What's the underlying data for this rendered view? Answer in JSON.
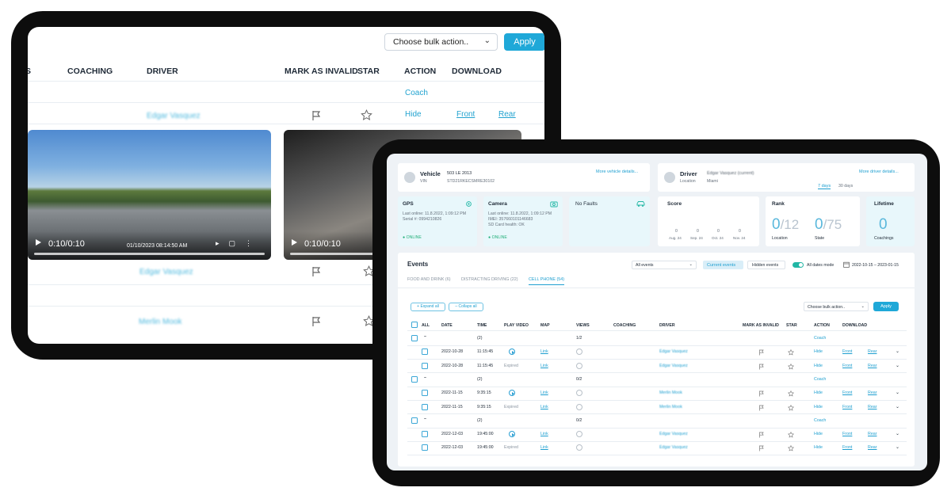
{
  "back": {
    "bulk_select": "Choose bulk action..",
    "apply": "Apply",
    "headers": [
      "S",
      "COACHING",
      "DRIVER",
      "MARK AS INVALID",
      "STAR",
      "ACTION",
      "DOWNLOAD"
    ],
    "coach": "Coach",
    "hide": "Hide",
    "front": "Front",
    "rear": "Rear",
    "drivers": [
      "Edgar Vasquez",
      "Edgar Vasquez",
      "Merlin Mook"
    ],
    "video1": {
      "time": "0:10/0:10",
      "stamp": "01/10/2023 08:14:50 AM"
    },
    "video2": {
      "time": "0:10/0:10"
    }
  },
  "front": {
    "vehicle": {
      "title": "Vehicle",
      "name": "503 LE 2013",
      "vin_label": "VIN",
      "vin": "STD21RKECSMRE30102",
      "more": "More vehicle details..."
    },
    "driver": {
      "title": "Driver",
      "name": "Edgar Vasquez (current)",
      "location_label": "Location",
      "location": "Miami",
      "more": "More driver details...",
      "range_tabs": [
        "7 days",
        "30 days"
      ]
    },
    "gps": {
      "title": "GPS",
      "last_online": "Last online: 11.8.2022, 1:09:12 PM",
      "serial": "Serial #: 0994210826",
      "status": "ONLINE"
    },
    "camera": {
      "title": "Camera",
      "last_online": "Last online: 11.8.2022, 1:09:12 PM",
      "imei": "IMEI: 357660101146683",
      "sd": "SD Card health: OK",
      "status": "ONLINE"
    },
    "faults": {
      "title": "No Faults"
    },
    "score": {
      "title": "Score",
      "values": [
        "0",
        "0",
        "0",
        "0"
      ],
      "dates": [
        "Aug. 24",
        "Sep. 24",
        "Oct. 24",
        "Nov. 24"
      ]
    },
    "rank": {
      "title": "Rank",
      "location": {
        "value": "0",
        "total": "/12",
        "label": "Location"
      },
      "state": {
        "value": "0",
        "total": "/75",
        "label": "State"
      }
    },
    "lifetime": {
      "title": "Lifetime",
      "value": "0",
      "label": "Coachings"
    },
    "events": {
      "title": "Events",
      "filter": "All events",
      "current": "Current events",
      "hidden": "Hidden events",
      "all_dates": "All dates mode",
      "date_range": "2022-10-15 – 2023-01-15",
      "tabs": [
        "FOOD AND DRINK (6)",
        "DISTRACTING DRIVING (22)",
        "CELL PHONE (54)"
      ],
      "expand": "+ Expand all",
      "collapse": "– Collaps all",
      "bulk": "Choose bulk action..",
      "apply": "Apply",
      "columns": [
        "ALL",
        "DATE",
        "TIME",
        "PLAY VIDEO",
        "MAP",
        "VIEWS",
        "COACHING",
        "DRIVER",
        "MARK AS INVALID",
        "STAR",
        "ACTION",
        "DOWNLOAD"
      ],
      "rows": [
        {
          "group": true,
          "date": "2022-10-28",
          "time": "(2)",
          "views": "1/2",
          "action": "Coach"
        },
        {
          "group": false,
          "date": "2022-10-28",
          "time": "11:15:45",
          "play": "icon",
          "map": "Link",
          "driver": "Edgar Vasquez",
          "action": "Hide",
          "front": "Front",
          "rear": "Rear"
        },
        {
          "group": false,
          "date": "2022-10-28",
          "time": "11:15:45",
          "play": "Expired",
          "map": "Link",
          "driver": "Edgar Vasquez",
          "action": "Hide",
          "front": "Front",
          "rear": "Rear"
        },
        {
          "group": true,
          "date": "2022-11-15",
          "time": "(2)",
          "views": "0/2",
          "action": "Coach"
        },
        {
          "group": false,
          "date": "2022-11-15",
          "time": "9:35:15",
          "play": "icon",
          "map": "Link",
          "driver": "Merlin Mook",
          "action": "Hide",
          "front": "Front",
          "rear": "Rear"
        },
        {
          "group": false,
          "date": "2022-11-15",
          "time": "9:35:15",
          "play": "Expired",
          "map": "Link",
          "driver": "Merlin Mook",
          "action": "Hide",
          "front": "Front",
          "rear": "Rear"
        },
        {
          "group": true,
          "date": "2022-12-03",
          "time": "(2)",
          "views": "0/2",
          "action": "Coach"
        },
        {
          "group": false,
          "date": "2022-12-03",
          "time": "19:45:00",
          "play": "icon",
          "map": "Link",
          "driver": "Edgar Vasquez",
          "action": "Hide",
          "front": "Front",
          "rear": "Rear"
        },
        {
          "group": false,
          "date": "2022-12-03",
          "time": "19:45:00",
          "play": "Expired",
          "map": "Link",
          "driver": "Edgar Vasquez",
          "action": "Hide",
          "front": "Front",
          "rear": "Rear"
        }
      ]
    }
  }
}
